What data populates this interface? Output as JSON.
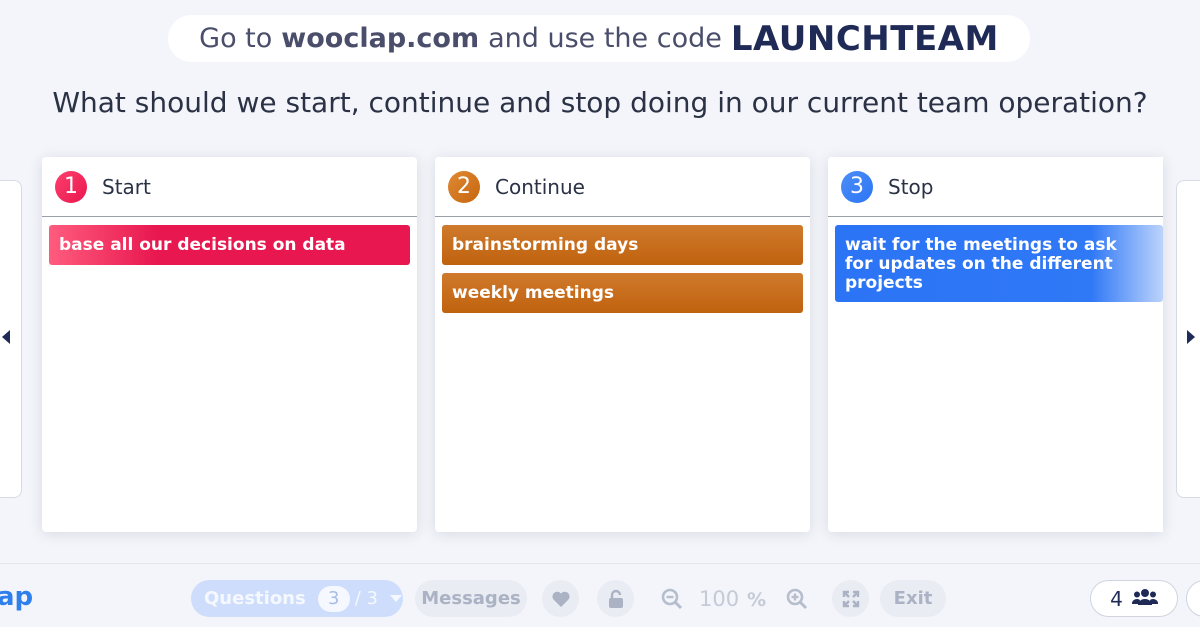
{
  "banner": {
    "prefix": "Go to",
    "site": "wooclap.com",
    "middle": "and use the code",
    "code": "LAUNCHTEAM"
  },
  "question": "What should we start, continue and stop doing in our current team operation?",
  "columns": [
    {
      "number": "1",
      "title": "Start",
      "color": "#e8174f",
      "cards": [
        "base all our decisions on data"
      ]
    },
    {
      "number": "2",
      "title": "Continue",
      "color": "#c6650f",
      "cards": [
        "brainstorming days",
        "weekly meetings"
      ]
    },
    {
      "number": "3",
      "title": "Stop",
      "color": "#2b74f5",
      "cards": [
        "wait for the meetings to ask for updates on the different projects"
      ]
    }
  ],
  "toolbar": {
    "logo": "ap",
    "questions_label": "Questions",
    "question_current": "3",
    "question_total": "/ 3",
    "messages_label": "Messages",
    "zoom_value": "100",
    "zoom_unit": "%",
    "exit_label": "Exit",
    "participants": "4"
  },
  "icons": {
    "left_arrow": "caret-left-icon",
    "right_arrow": "caret-right-icon",
    "heart": "heart-icon",
    "lock": "lock-icon",
    "zoom_out": "zoom-out-icon",
    "zoom_in": "zoom-in-icon",
    "fullscreen": "expand-icon",
    "users": "users-icon"
  }
}
